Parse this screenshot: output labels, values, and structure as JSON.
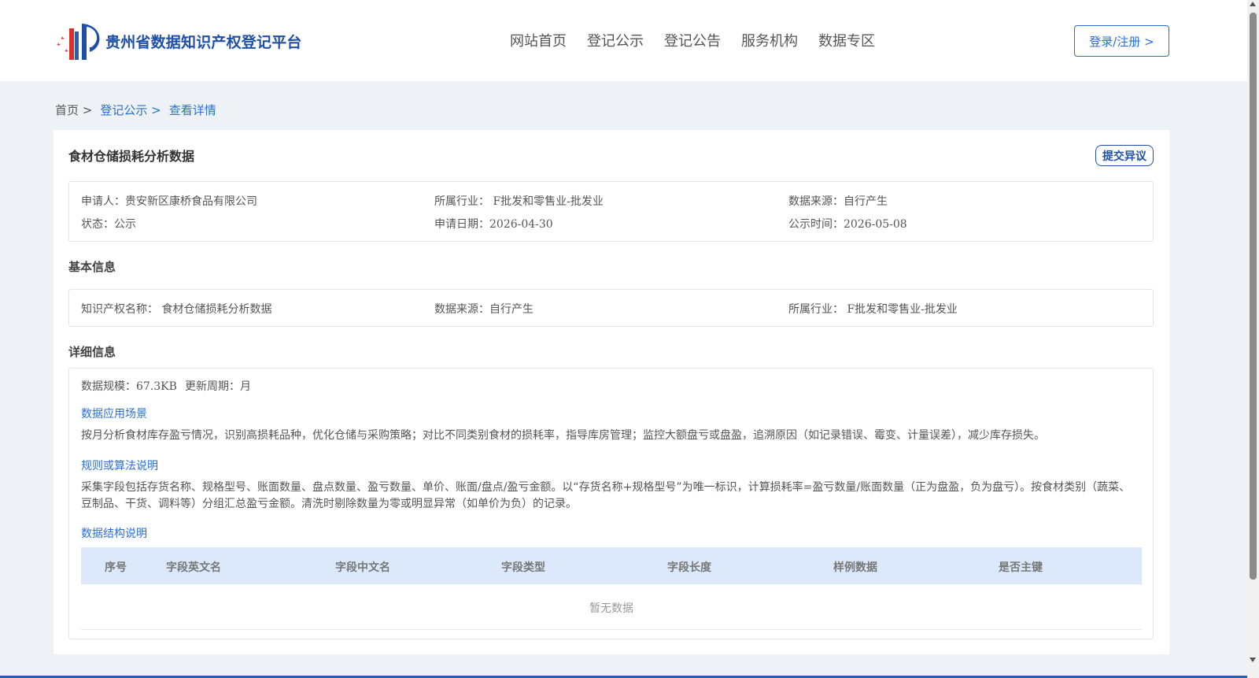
{
  "header": {
    "logo_text": "贵州省数据知识产权登记平台",
    "nav": [
      "网站首页",
      "登记公示",
      "登记公告",
      "服务机构",
      "数据专区"
    ],
    "login_label": "登录/注册 >"
  },
  "breadcrumb": {
    "home": "首页 >",
    "link": "登记公示 >",
    "current": "查看详情"
  },
  "detail": {
    "title": "食材仓储损耗分析数据",
    "dispute_label": "提交异议",
    "summary": {
      "applicant": "申请人：贵安新区康桥食品有限公司",
      "industry": "所属行业： F批发和零售业-批发业",
      "source": "数据来源：自行产生",
      "status": "状态：公示",
      "apply_date": "申请日期：2026-04-30",
      "publish_date": "公示时间：2026-05-08"
    },
    "basic_title": "基本信息",
    "basic": {
      "ip_name": "知识产权名称： 食材仓储损耗分析数据",
      "source": "数据来源：自行产生",
      "industry": "所属行业： F批发和零售业-批发业"
    },
    "detail_title": "详细信息",
    "scale": "数据规模：67.3KB",
    "cycle": "更新周期：月",
    "scenario_heading": "数据应用场景",
    "scenario_text": "按月分析食材库存盈亏情况，识别高损耗品种，优化仓储与采购策略；对比不同类别食材的损耗率，指导库房管理；监控大额盘亏或盘盈，追溯原因（如记录错误、霉变、计量误差），减少库存损失。",
    "rule_heading": "规则或算法说明",
    "rule_text": "采集字段包括存货名称、规格型号、账面数量、盘点数量、盈亏数量、单价、账面/盘点/盈亏金额。以“存货名称+规格型号”为唯一标识，计算损耗率=盈亏数量/账面数量（正为盘盈，负为盘亏）。按食材类别（蔬菜、豆制品、干货、调料等）分组汇总盈亏金额。清洗时剔除数量为零或明显异常（如单价为负）的记录。",
    "structure_heading": "数据结构说明",
    "table_headers": [
      "序号",
      "字段英文名",
      "字段中文名",
      "字段类型",
      "字段长度",
      "样例数据",
      "是否主键"
    ],
    "empty_text": "暂无数据"
  },
  "colors": {
    "brand": "#1f4fa8",
    "link": "#2a6fd6",
    "table_header_bg": "#dbe9fb",
    "page_bg": "#eef2f6"
  }
}
